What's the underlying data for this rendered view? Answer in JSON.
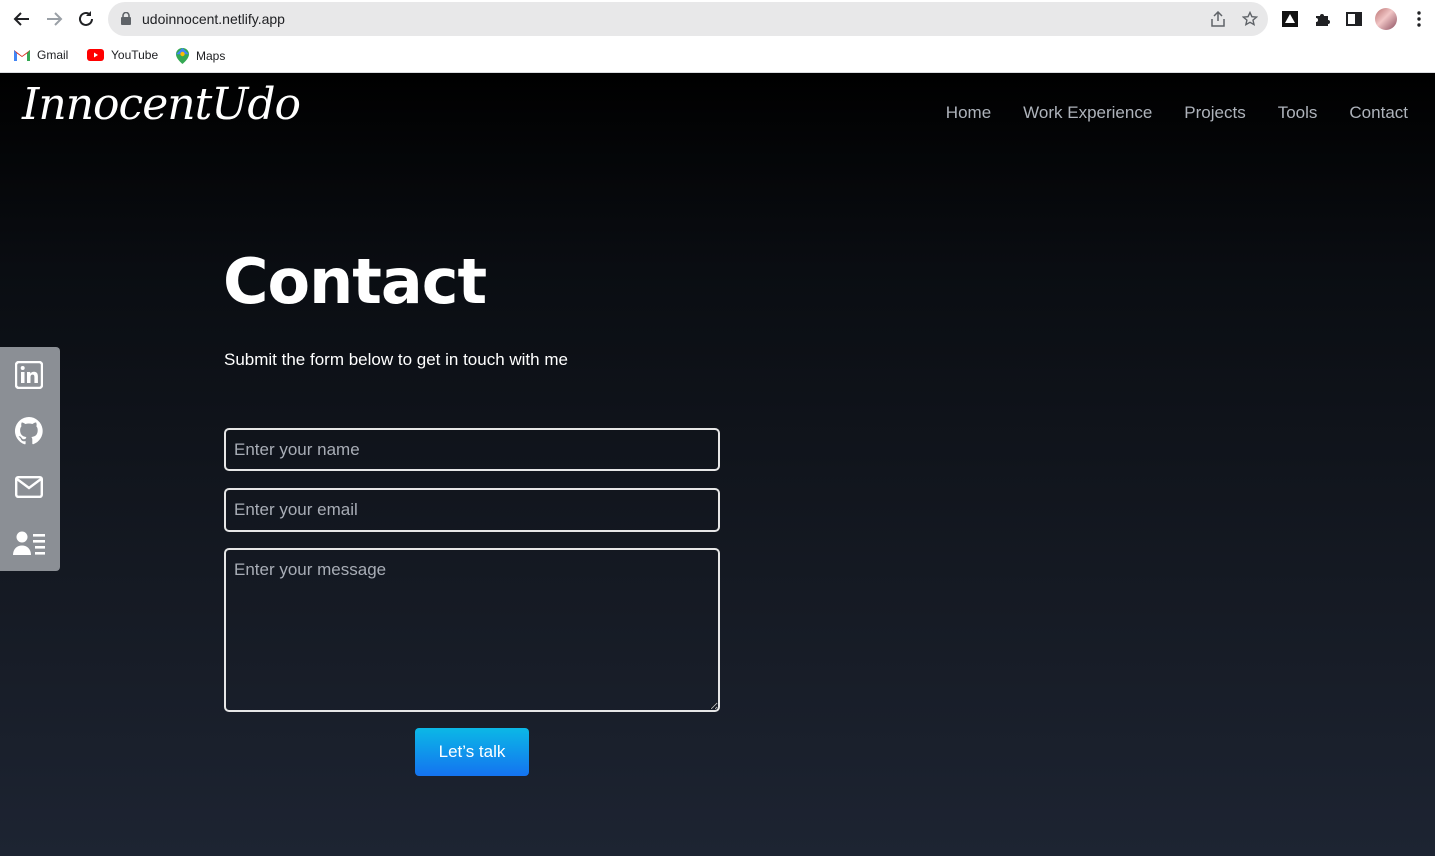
{
  "browser": {
    "url": "udoinnocent.netlify.app",
    "bookmarks": [
      {
        "label": "Gmail",
        "icon": "gmail-icon"
      },
      {
        "label": "YouTube",
        "icon": "youtube-icon"
      },
      {
        "label": "Maps",
        "icon": "maps-icon"
      }
    ]
  },
  "site": {
    "logo": "InnocentUdo",
    "nav": [
      "Home",
      "Work Experience",
      "Projects",
      "Tools",
      "Contact"
    ]
  },
  "contact": {
    "heading": "Contact",
    "subtitle": "Submit the form below to get in touch with me",
    "name_placeholder": "Enter your name",
    "email_placeholder": "Enter your email",
    "message_placeholder": "Enter your message",
    "submit_label": "Let’s talk"
  },
  "social": [
    "linkedin-icon",
    "github-icon",
    "mail-icon",
    "contact-card-icon"
  ],
  "colors": {
    "accent_top": "#0bb8e6",
    "accent_bottom": "#1473f0",
    "sidebar": "#8b8f95",
    "nav_text": "#aeb3bb"
  }
}
